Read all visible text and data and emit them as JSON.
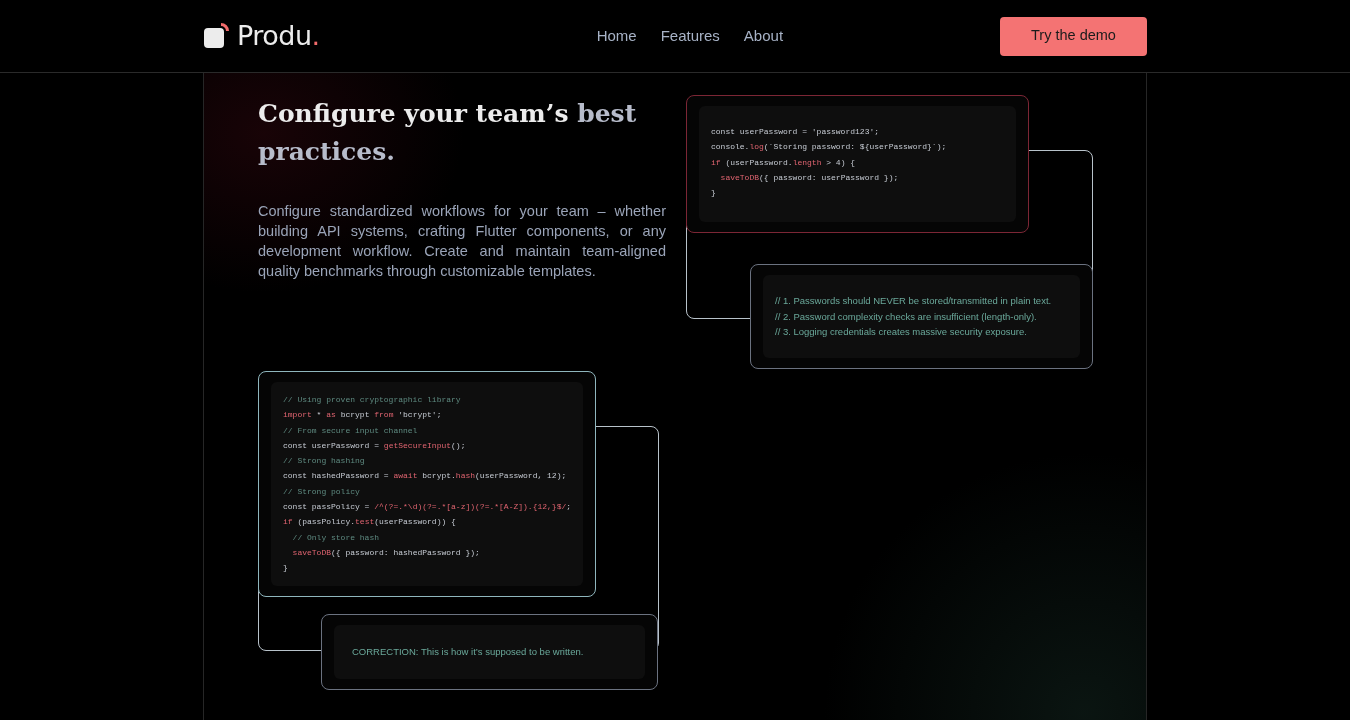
{
  "brand": {
    "name": "Produ",
    "dot": "."
  },
  "nav": [
    {
      "label": "Home"
    },
    {
      "label": "Features"
    },
    {
      "label": "About"
    }
  ],
  "cta": {
    "label": "Try the demo"
  },
  "hero": {
    "heading": "Configure your team’s ",
    "heading_accent": "best practices.",
    "text": "Configure standardized workflows for your team – whether building API systems, crafting Flutter components, or any development workflow. Create and maintain team-aligned quality benchmarks through customizable templates."
  },
  "bad_code": [
    [
      {
        "t": "const userPassword = 'password123';",
        "kind": "plain"
      }
    ],
    [
      {
        "t": "console.",
        "kind": "plain"
      },
      {
        "t": "log",
        "kind": "accent"
      },
      {
        "t": "(`Storing password: ${userPassword}`);",
        "kind": "plain"
      }
    ],
    [
      {
        "t": "if",
        "kind": "accent"
      },
      {
        "t": " (userPassword.",
        "kind": "plain"
      },
      {
        "t": "length",
        "kind": "accent"
      },
      {
        "t": " > 4) {",
        "kind": "plain"
      }
    ],
    [
      {
        "t": "  saveToDB",
        "kind": "accent"
      },
      {
        "t": "({ password: userPassword });",
        "kind": "plain"
      }
    ],
    [
      {
        "t": "}",
        "kind": "plain"
      }
    ]
  ],
  "issues": [
    "// 1. Passwords should NEVER be stored/transmitted in plain text.",
    "// 2. Password complexity checks are insufficient (length-only).",
    "// 3. Logging credentials creates massive security exposure."
  ],
  "good_code": [
    [
      {
        "t": "// Using proven cryptographic library",
        "kind": "comment"
      }
    ],
    [
      {
        "t": "import",
        "kind": "accent"
      },
      {
        "t": " * ",
        "kind": "plain"
      },
      {
        "t": "as",
        "kind": "accent"
      },
      {
        "t": " bcrypt ",
        "kind": "plain"
      },
      {
        "t": "from",
        "kind": "accent"
      },
      {
        "t": " 'bcrypt';",
        "kind": "plain"
      }
    ],
    [
      {
        "t": "// From secure input channel",
        "kind": "comment"
      }
    ],
    [
      {
        "t": "const userPassword = ",
        "kind": "plain"
      },
      {
        "t": "getSecureInput",
        "kind": "accent"
      },
      {
        "t": "();",
        "kind": "plain"
      }
    ],
    [
      {
        "t": "// Strong hashing",
        "kind": "comment"
      }
    ],
    [
      {
        "t": "const hashedPassword = ",
        "kind": "plain"
      },
      {
        "t": "await",
        "kind": "accent"
      },
      {
        "t": " bcrypt.",
        "kind": "plain"
      },
      {
        "t": "hash",
        "kind": "accent"
      },
      {
        "t": "(userPassword, 12);",
        "kind": "plain"
      }
    ],
    [
      {
        "t": "// Strong policy",
        "kind": "comment"
      }
    ],
    [
      {
        "t": "const passPolicy = ",
        "kind": "plain"
      },
      {
        "t": "/^(?=.*\\d)(?=.*[a-z])(?=.*[A-Z]).{12,}$/",
        "kind": "accent"
      },
      {
        "t": ";",
        "kind": "plain"
      }
    ],
    [
      {
        "t": "if",
        "kind": "accent"
      },
      {
        "t": " (passPolicy.",
        "kind": "plain"
      },
      {
        "t": "test",
        "kind": "accent"
      },
      {
        "t": "(userPassword)) {",
        "kind": "plain"
      }
    ],
    [
      {
        "t": "  // Only store hash",
        "kind": "comment"
      }
    ],
    [
      {
        "t": "  saveToDB",
        "kind": "accent"
      },
      {
        "t": "({ password: hashedPassword });",
        "kind": "plain"
      }
    ],
    [
      {
        "t": "}",
        "kind": "plain"
      }
    ]
  ],
  "correction": "CORRECTION: This is how it’s supposed to be written."
}
